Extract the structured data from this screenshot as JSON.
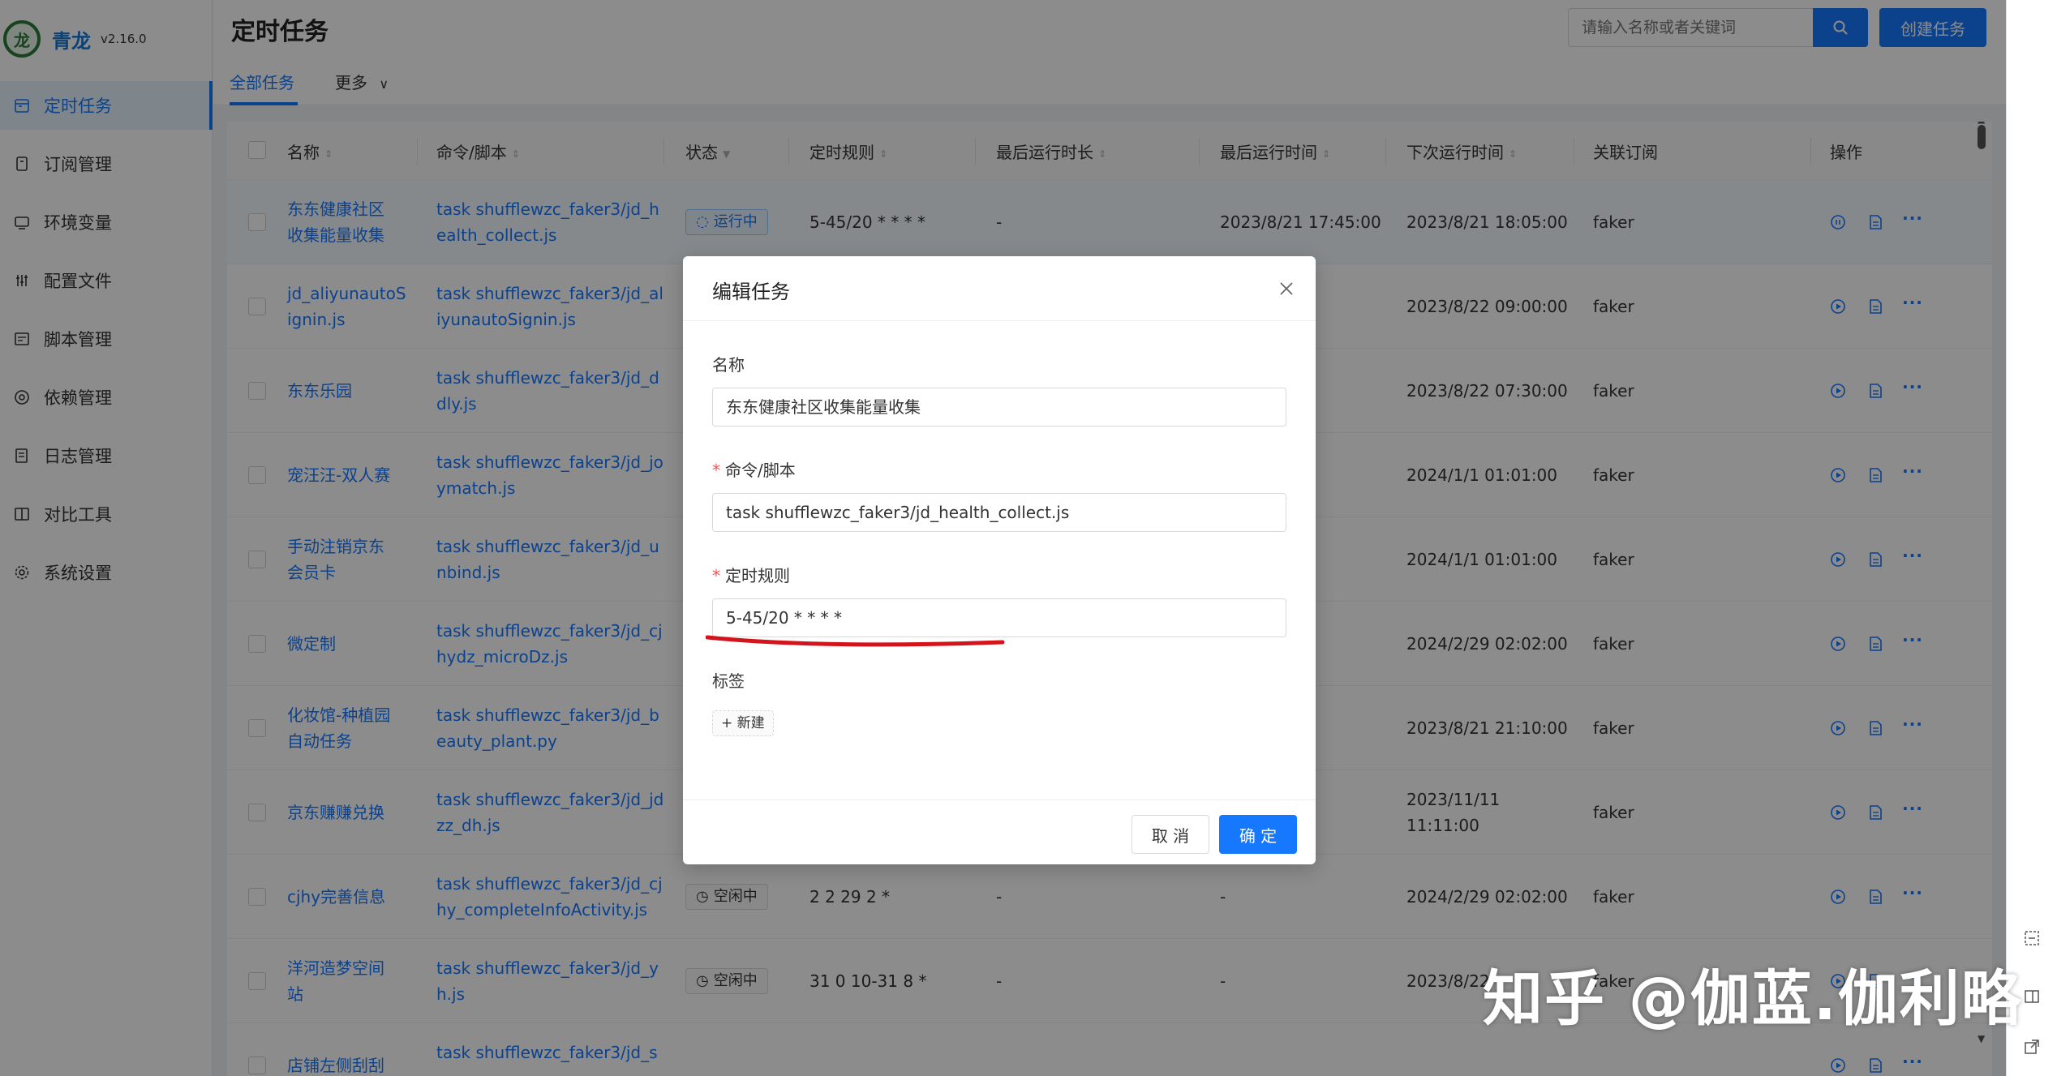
{
  "app": {
    "name": "青龙",
    "version": "v2.16.0"
  },
  "sidebar": {
    "items": [
      {
        "label": "定时任务",
        "icon": "calendar-icon"
      },
      {
        "label": "订阅管理",
        "icon": "subscription-icon"
      },
      {
        "label": "环境变量",
        "icon": "variables-icon"
      },
      {
        "label": "配置文件",
        "icon": "sliders-icon"
      },
      {
        "label": "脚本管理",
        "icon": "script-icon"
      },
      {
        "label": "依赖管理",
        "icon": "dependency-icon"
      },
      {
        "label": "日志管理",
        "icon": "log-icon"
      },
      {
        "label": "对比工具",
        "icon": "diff-icon"
      },
      {
        "label": "系统设置",
        "icon": "gear-icon"
      }
    ]
  },
  "header": {
    "title": "定时任务",
    "search_placeholder": "请输入名称或者关键词",
    "create_label": "创建任务"
  },
  "tabs": {
    "all": "全部任务",
    "more": "更多"
  },
  "table": {
    "columns": {
      "name": "名称",
      "command": "命令/脚本",
      "status": "状态",
      "schedule": "定时规则",
      "duration": "最后运行时长",
      "last_run": "最后运行时间",
      "next_run": "下次运行时间",
      "subscription": "关联订阅",
      "actions": "操作"
    },
    "rows": [
      {
        "name1": "东东健康社区",
        "name2": "收集能量收集",
        "cmd1": "task shufflewzc_faker3/jd_h",
        "cmd2": "ealth_collect.js",
        "status": "运行中",
        "schedule": "5-45/20 * * * *",
        "duration": "-",
        "last_run": "2023/8/21 17:45:00",
        "next1": "2023/8/21 18:05:00",
        "next2": "",
        "sub": "faker"
      },
      {
        "name1": "jd_aliyunautoS",
        "name2": "ignin.js",
        "cmd1": "task shufflewzc_faker3/jd_al",
        "cmd2": "iyunautoSignin.js",
        "status": "",
        "schedule": "",
        "duration": "",
        "last_run": "",
        "next1": "2023/8/22 09:00:00",
        "next2": "",
        "sub": "faker"
      },
      {
        "name1": "东东乐园",
        "name2": "",
        "cmd1": "task shufflewzc_faker3/jd_d",
        "cmd2": "dly.js",
        "status": "",
        "schedule": "",
        "duration": "",
        "last_run": "",
        "next1": "2023/8/22 07:30:00",
        "next2": "",
        "sub": "faker"
      },
      {
        "name1": "宠汪汪-双人赛",
        "name2": "",
        "cmd1": "task shufflewzc_faker3/jd_jo",
        "cmd2": "ymatch.js",
        "status": "",
        "schedule": "",
        "duration": "",
        "last_run": "",
        "next1": "2024/1/1 01:01:00",
        "next2": "",
        "sub": "faker"
      },
      {
        "name1": "手动注销京东",
        "name2": "会员卡",
        "cmd1": "task shufflewzc_faker3/jd_u",
        "cmd2": "nbind.js",
        "status": "",
        "schedule": "",
        "duration": "",
        "last_run": "",
        "next1": "2024/1/1 01:01:00",
        "next2": "",
        "sub": "faker"
      },
      {
        "name1": "微定制",
        "name2": "",
        "cmd1": "task shufflewzc_faker3/jd_cj",
        "cmd2": "hydz_microDz.js",
        "status": "",
        "schedule": "",
        "duration": "",
        "last_run": "",
        "next1": "2024/2/29 02:02:00",
        "next2": "",
        "sub": "faker"
      },
      {
        "name1": "化妆馆-种植园",
        "name2": "自动任务",
        "cmd1": "task shufflewzc_faker3/jd_b",
        "cmd2": "eauty_plant.py",
        "status": "",
        "schedule": "",
        "duration": "",
        "last_run": "",
        "next1": "2023/8/21 21:10:00",
        "next2": "",
        "sub": "faker"
      },
      {
        "name1": "京东赚赚兑换",
        "name2": "",
        "cmd1": "task shufflewzc_faker3/jd_jd",
        "cmd2": "zz_dh.js",
        "status": "",
        "schedule": "",
        "duration": "",
        "last_run": "",
        "next1": "2023/11/11",
        "next2": "11:11:00",
        "sub": "faker"
      },
      {
        "name1": "cjhy完善信息",
        "name2": "",
        "cmd1": "task shufflewzc_faker3/jd_cj",
        "cmd2": "hy_completeInfoActivity.js",
        "status": "空闲中",
        "schedule": "2 2 29 2 *",
        "duration": "-",
        "last_run": "-",
        "next1": "2024/2/29 02:02:00",
        "next2": "",
        "sub": "faker"
      },
      {
        "name1": "洋河造梦空间",
        "name2": "站",
        "cmd1": "task shufflewzc_faker3/jd_y",
        "cmd2": "h.js",
        "status": "空闲中",
        "schedule": "31 0 10-31 8 *",
        "duration": "-",
        "last_run": "-",
        "next1": "2023/8/22",
        "next2": "",
        "sub": "faker"
      },
      {
        "name1": "店铺左侧刮刮",
        "name2": "",
        "cmd1": "task shufflewzc_faker3/jd_s",
        "cmd2": "",
        "status": "",
        "schedule": "",
        "duration": "",
        "last_run": "",
        "next1": "",
        "next2": "",
        "sub": ""
      }
    ]
  },
  "modal": {
    "title": "编辑任务",
    "name_label": "名称",
    "name_value": "东东健康社区收集能量收集",
    "command_label": "命令/脚本",
    "command_value": "task shufflewzc_faker3/jd_health_collect.js",
    "schedule_label": "定时规则",
    "schedule_value": "5-45/20 * * * *",
    "tags_label": "标签",
    "new_tag_label": "+ 新建",
    "cancel_label": "取 消",
    "ok_label": "确 定"
  },
  "watermark": "知乎 @伽蓝.伽利略",
  "colors": {
    "primary": "#1677ff",
    "required": "#ff4d4f",
    "annotation": "#d3141c",
    "logo": "#2d7a3a"
  }
}
